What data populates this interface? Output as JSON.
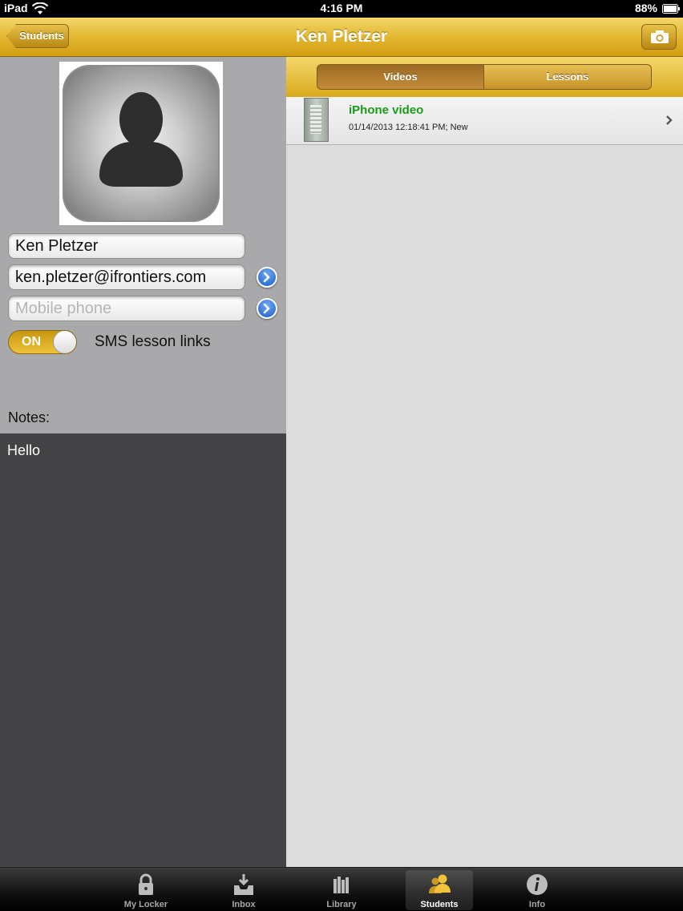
{
  "status_bar": {
    "device": "iPad",
    "time": "4:16 PM",
    "battery": "88%"
  },
  "nav": {
    "back_label": "Students",
    "title": "Ken Pletzer",
    "camera_icon": "camera-icon"
  },
  "profile": {
    "name": "Ken Pletzer",
    "email": "ken.pletzer@ifrontiers.com",
    "phone_placeholder": "Mobile phone",
    "sms_toggle": "ON",
    "sms_label": "SMS lesson links",
    "notes_label": "Notes:",
    "notes_text": "Hello"
  },
  "segments": {
    "videos": "Videos",
    "lessons": "Lessons",
    "selected": "Videos"
  },
  "videos": [
    {
      "title": "iPhone video",
      "meta": "01/14/2013 12:18:41 PM; New"
    }
  ],
  "tab_bar": {
    "tabs": [
      {
        "label": "My Locker",
        "icon": "lock-icon"
      },
      {
        "label": "Inbox",
        "icon": "inbox-icon"
      },
      {
        "label": "Library",
        "icon": "library-icon"
      },
      {
        "label": "Students",
        "icon": "students-icon",
        "selected": true
      },
      {
        "label": "Info",
        "icon": "info-icon"
      }
    ]
  },
  "colors": {
    "accent_gold": "#e2b731",
    "video_title_green": "#1a9a1a",
    "notes_background": "#434345"
  }
}
